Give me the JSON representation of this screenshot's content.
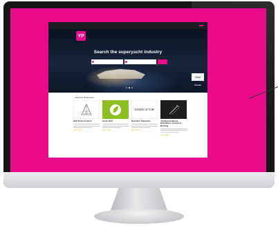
{
  "colors": {
    "brand": "#ea0b8c",
    "bezel": "#161616",
    "page_bg": "#ffffff"
  },
  "site": {
    "topbar": {
      "links": [
        "",
        ""
      ],
      "cta": ""
    },
    "logo": {
      "glyph": "YP",
      "text": ""
    },
    "nav": [
      "",
      "",
      "",
      "",
      "",
      "",
      "",
      ""
    ],
    "hero": {
      "title": "Search the superyacht industry",
      "subtitle": "",
      "search_placeholder": "",
      "location_placeholder": "",
      "search_button": "",
      "slides_total": 3,
      "active_slide": 1
    },
    "advert": {
      "logo_text": "clean",
      "caption": "Lürssen"
    },
    "featured": {
      "title": "Featured Businesses",
      "cards": [
        {
          "name": "Wolf Evans & Gerrin",
          "category": "",
          "icon": "yacht-sketch-icon",
          "rating": "★★★★★"
        },
        {
          "name": "Green Wolf",
          "category": "",
          "icon": "leaf-logo-icon",
          "rating": "★★★★★"
        },
        {
          "name": "Derecktor Shipyards",
          "category": "",
          "logo_text": "DERECKTOR",
          "rating": "★★★★★"
        },
        {
          "name": "Yachting Solutions, Refinishers, Custom & Bending",
          "category": "",
          "icon": "brush-sketch-icon",
          "rating": "★★★★★"
        }
      ]
    }
  }
}
